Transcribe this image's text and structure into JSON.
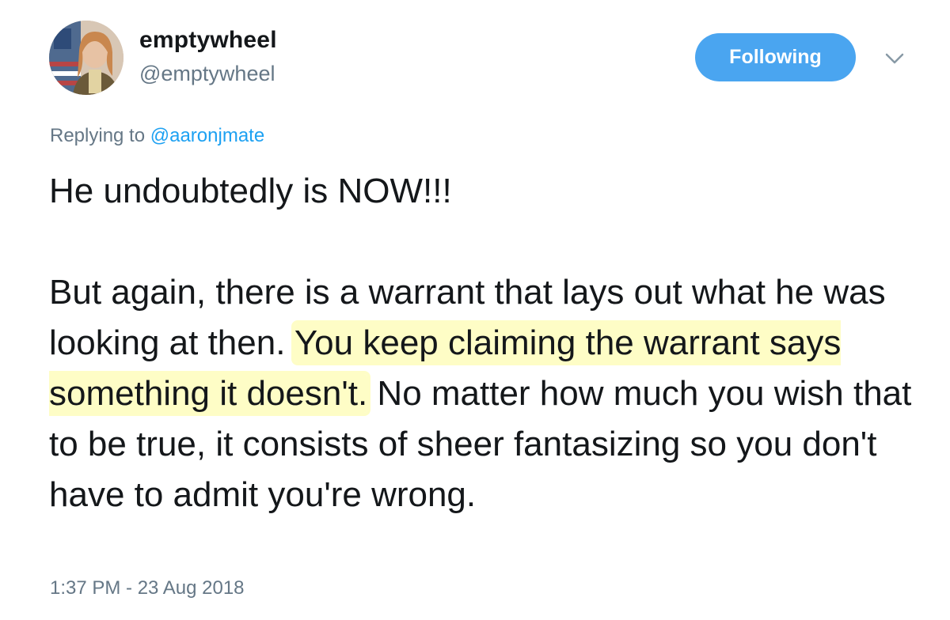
{
  "tweet": {
    "author": {
      "display_name": "emptywheel",
      "handle": "@emptywheel",
      "avatar_icon": "profile-photo"
    },
    "follow_button": {
      "label": "Following",
      "color": "#4aa5f0"
    },
    "menu_icon": "chevron-down-icon",
    "reply": {
      "prefix": "Replying to",
      "mention": "@aaronjmate"
    },
    "body": {
      "line1": "He undoubtedly is NOW!!!",
      "para2_before": "But again, there is a warrant that lays out what he was looking at then. ",
      "para2_highlight": "You keep claiming the warrant says something it doesn't.",
      "para2_after": " No matter how much you wish that to be true, it consists of sheer fantasizing so you don't have to admit you're wrong.",
      "highlight_color": "#fefdc6"
    },
    "timestamp": "1:37 PM - 23 Aug 2018"
  }
}
